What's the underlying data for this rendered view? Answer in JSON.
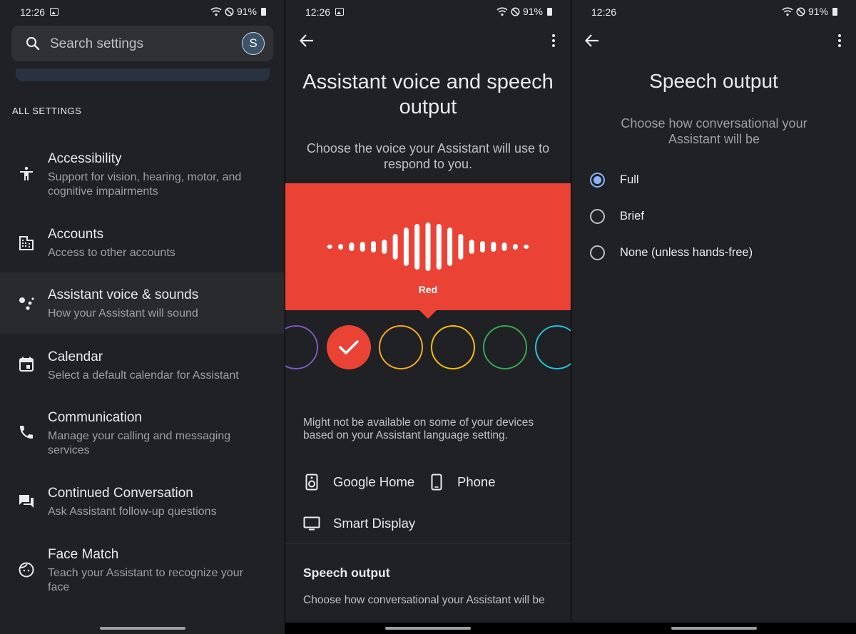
{
  "status": {
    "time": "12:26",
    "battery": "91%"
  },
  "search": {
    "placeholder": "Search settings",
    "avatar_initial": "S"
  },
  "settings": {
    "section_header": "ALL SETTINGS",
    "items": [
      {
        "title": "Accessibility",
        "subtitle": "Support for vision, hearing, motor, and cognitive impairments",
        "icon": "accessibility-icon"
      },
      {
        "title": "Accounts",
        "subtitle": "Access to other accounts",
        "icon": "accounts-icon"
      },
      {
        "title": "Assistant voice & sounds",
        "subtitle": "How your Assistant will sound",
        "icon": "assistant-icon",
        "highlighted": true
      },
      {
        "title": "Calendar",
        "subtitle": "Select a default calendar for Assistant",
        "icon": "calendar-icon"
      },
      {
        "title": "Communication",
        "subtitle": "Manage your calling and messaging services",
        "icon": "phone-icon"
      },
      {
        "title": "Continued Conversation",
        "subtitle": "Ask Assistant follow-up questions",
        "icon": "chat-icon"
      },
      {
        "title": "Face Match",
        "subtitle": "Teach your Assistant to recognize your face",
        "icon": "face-icon"
      }
    ]
  },
  "voice": {
    "title": "Assistant voice and speech output",
    "subtitle": "Choose the voice your Assistant will use to respond to you.",
    "selected_voice": "Red",
    "selected_color": "#ea4335",
    "swatch_colors": [
      "#7e57c2",
      "#ea4335",
      "#f9a825",
      "#fbbc04",
      "#34a853",
      "#24c1e0"
    ],
    "note": "Might not be available on some of your devices based on your Assistant language setting.",
    "devices": [
      "Google Home",
      "Phone",
      "Smart Display"
    ],
    "speech_output_heading": "Speech output",
    "speech_output_sub": "Choose how conversational your Assistant will be"
  },
  "speech_output": {
    "title": "Speech output",
    "subtitle": "Choose how conversational your Assistant will be",
    "options": [
      "Full",
      "Brief",
      "None (unless hands-free)"
    ],
    "selected": "Full",
    "accent": "#8ab4f8"
  }
}
